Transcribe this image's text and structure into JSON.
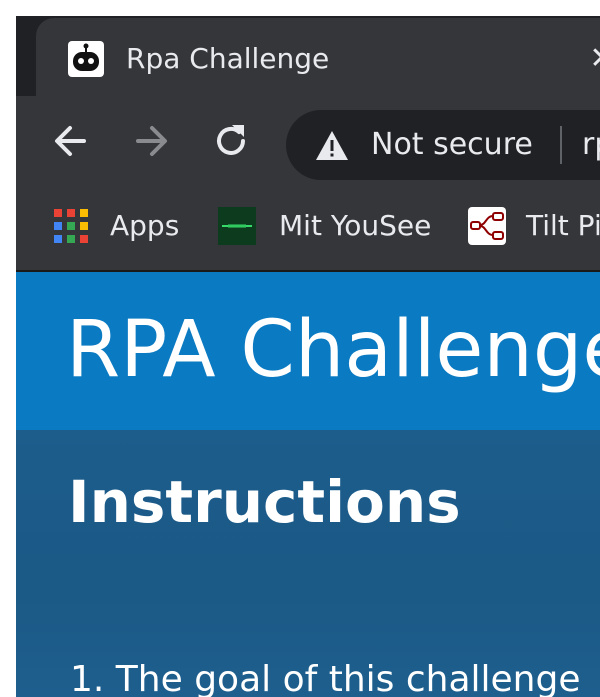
{
  "browser": {
    "tab": {
      "title": "Rpa Challenge",
      "favicon": "robot-icon",
      "close_label": "✕"
    },
    "toolbar": {
      "back": "arrow-left-icon",
      "forward": "arrow-right-icon",
      "reload": "reload-icon",
      "security_label": "Not secure",
      "url": "rp"
    },
    "bookmarks": [
      {
        "label": "Apps",
        "icon": "apps-grid-icon"
      },
      {
        "label": "Mit YouSee",
        "icon": "yousee-icon"
      },
      {
        "label": "Tilt Pi",
        "icon": "node-red-icon"
      }
    ]
  },
  "page": {
    "title": "RPA Challenge",
    "instructions_heading": "Instructions",
    "first_instruction": "1. The goal of this challenge"
  },
  "colors": {
    "header_blue": "#0a7ac2",
    "body_blue": "#1e5c8a",
    "chrome_dark": "#202124",
    "chrome_toolbar": "#35363a"
  }
}
